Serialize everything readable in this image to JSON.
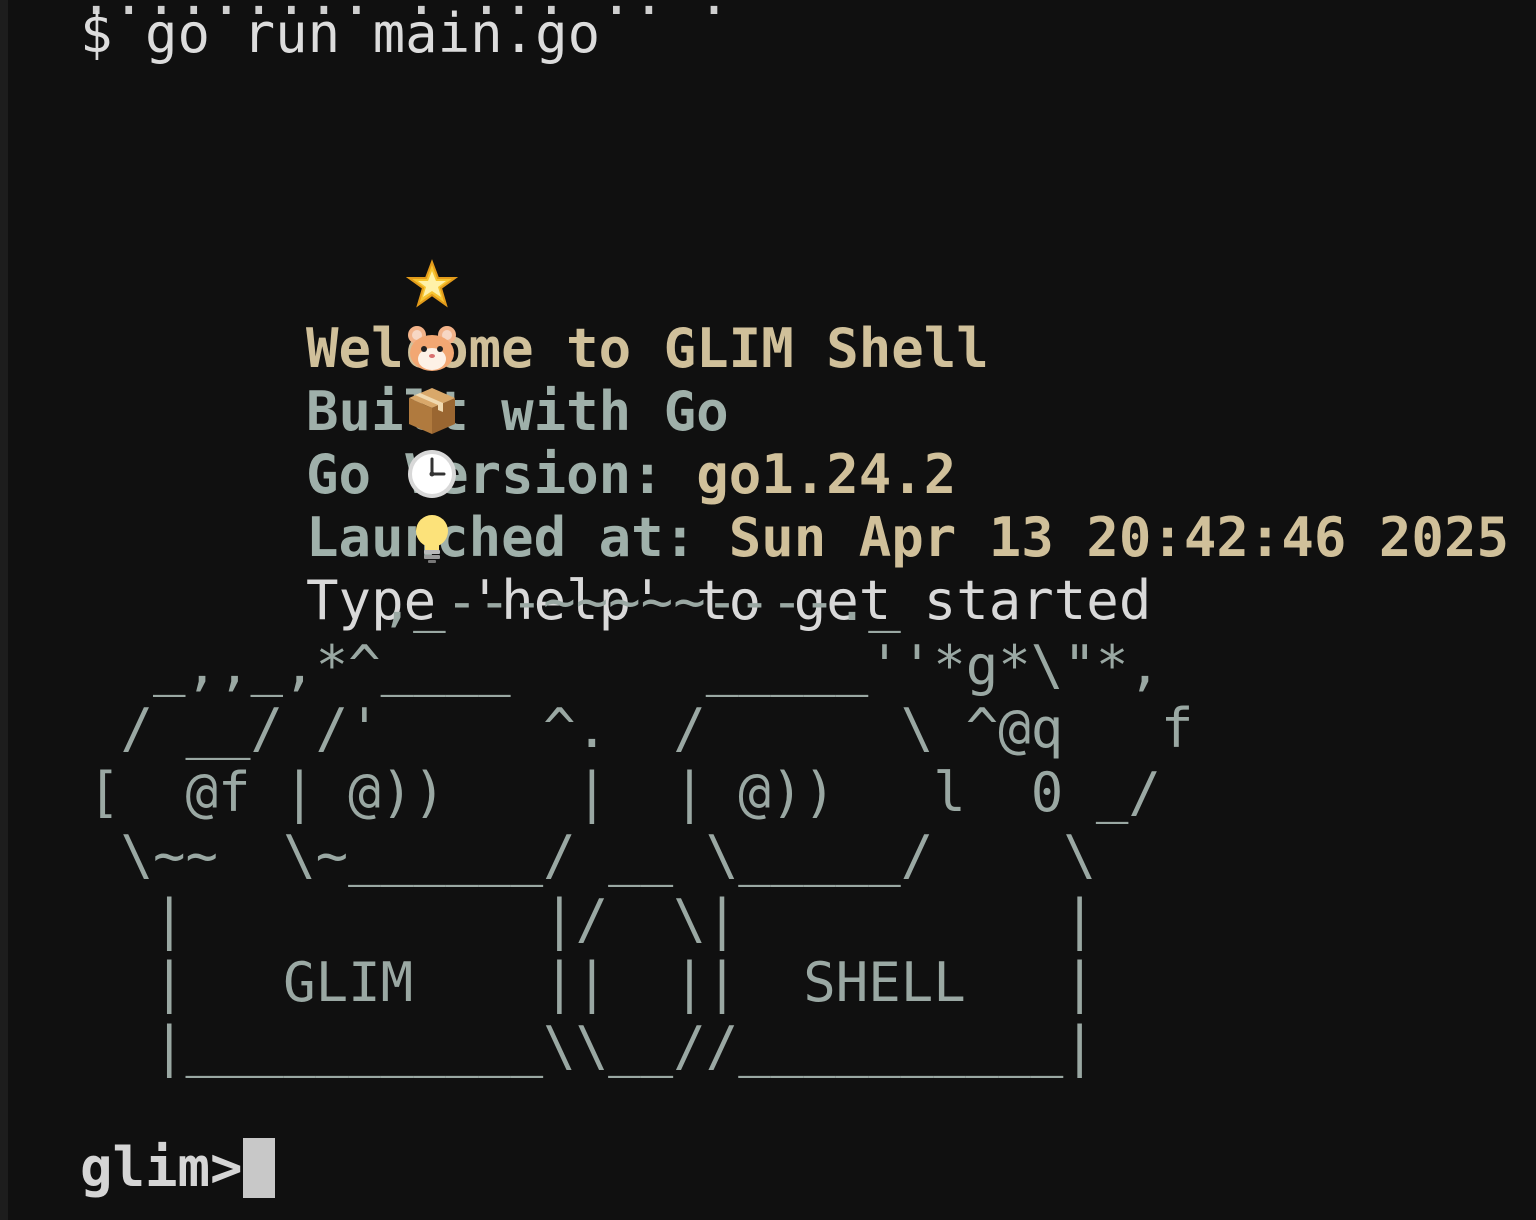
{
  "previous_output": "......... . ... .. .",
  "command": {
    "prompt_symbol": "$",
    "text": "go run main.go"
  },
  "banner": {
    "welcome": {
      "icon": "glowing-star-icon",
      "text": "Welcome to GLIM Shell"
    },
    "built": {
      "icon": "hamster-icon",
      "text": "Built with Go"
    },
    "version": {
      "icon": "package-icon",
      "label": "Go Version:",
      "value": "go1.24.2"
    },
    "launched": {
      "icon": "clock-icon",
      "label": "Launched at:",
      "value": "Sun Apr 13 20:42:46 2025"
    },
    "hint": {
      "icon": "lightbulb-icon",
      "text": "Type 'help' to get started"
    }
  },
  "ascii_art": "         ,_---~~~~~----._\n  _,,_,*^____      _____''*g*\\\"*,\n / __/ /'     ^.  /      \\ ^@q   f\n[  @f | @))    |  | @))   l  0 _/\n \\~~  \\~______/ __ \\_____/    \\\n  |           |/  \\|          |\n  |   GLIM    ||  ||  SHELL   |\n  |___________\\\\__//__________|",
  "prompt": {
    "text": "glim>",
    "input_value": ""
  },
  "colors": {
    "background": "#101010",
    "gold": "#d0c09a",
    "sage": "#9fb0aa",
    "text": "#d9d9d9"
  }
}
